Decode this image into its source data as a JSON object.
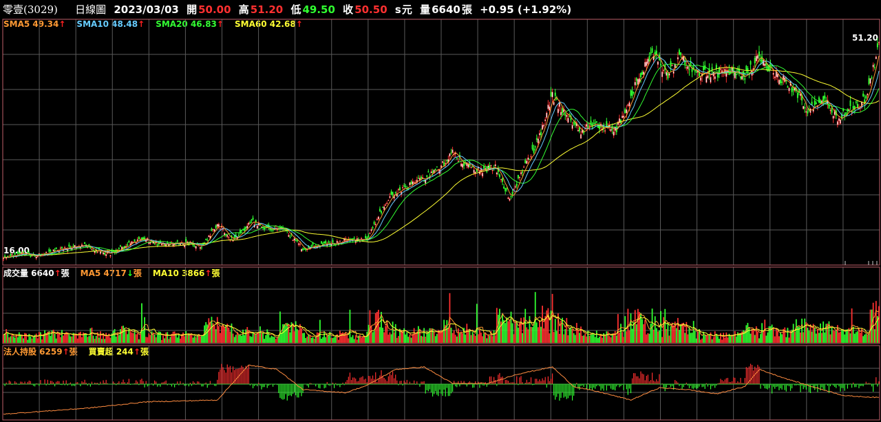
{
  "header": {
    "stock_name": "零壹(3029)",
    "chart_kind": "日線圖",
    "date": "2023/03/03",
    "open_label": "開",
    "open_value": "50.00",
    "high_label": "高",
    "high_value": "51.20",
    "low_label": "低",
    "low_value": "49.50",
    "close_label": "收",
    "close_value": "50.50",
    "currency_s": "s",
    "currency_label": "元",
    "volume_label": "量",
    "volume_value": "6640",
    "volume_unit": "張",
    "change": "+0.95 (+1.92%)"
  },
  "price_legend": [
    {
      "label": "SMA5",
      "value": "49.34",
      "color": "#ff9933",
      "dir": "up"
    },
    {
      "label": "SMA10",
      "value": "48.48",
      "color": "#66ccff",
      "dir": "up"
    },
    {
      "label": "SMA20",
      "value": "46.83",
      "color": "#33ff33",
      "dir": "up"
    },
    {
      "label": "SMA60",
      "value": "42.68",
      "color": "#ffff33",
      "dir": "up"
    }
  ],
  "volume_legend": [
    {
      "label": "成交量",
      "value": "6640",
      "unit": "張",
      "color": "#ffffff",
      "dir": "up"
    },
    {
      "label": "MA5",
      "value": "4717",
      "unit": "張",
      "color": "#ff9933",
      "dir": "down"
    },
    {
      "label": "MA10",
      "value": "3866",
      "unit": "張",
      "color": "#ffff33",
      "dir": "up"
    }
  ],
  "inst_legend": [
    {
      "label": "法人持股",
      "value": "6259",
      "unit": "張",
      "color": "#ff9933",
      "dir": "up"
    },
    {
      "label": "買賣超",
      "value": "244",
      "unit": "張",
      "color": "#ffff33",
      "dir": "up"
    }
  ],
  "chart_data": {
    "type": "line",
    "price_max_label": "51.20",
    "price_min_label": "16.00",
    "ylim": [
      16.0,
      51.2
    ],
    "colors": {
      "up": "#ff3030",
      "down": "#30ff30",
      "sma5": "#ff9933",
      "sma10": "#66ccff",
      "sma20": "#33ff33",
      "sma60": "#ffff33",
      "grid": "#5a5a5a",
      "frame": "#c0606a",
      "inst": "#ff8c40"
    },
    "close_keypoints": [
      [
        0,
        17.0
      ],
      [
        10,
        17.8
      ],
      [
        25,
        17.5
      ],
      [
        40,
        18.5
      ],
      [
        55,
        19.2
      ],
      [
        65,
        18.3
      ],
      [
        75,
        17.8
      ],
      [
        90,
        19.5
      ],
      [
        100,
        20.0
      ],
      [
        110,
        19.3
      ],
      [
        125,
        19.6
      ],
      [
        140,
        19.0
      ],
      [
        150,
        22.5
      ],
      [
        160,
        20.0
      ],
      [
        175,
        22.8
      ],
      [
        185,
        21.5
      ],
      [
        195,
        22.0
      ],
      [
        210,
        18.6
      ],
      [
        225,
        19.2
      ],
      [
        240,
        19.8
      ],
      [
        255,
        20.0
      ],
      [
        265,
        24.5
      ],
      [
        275,
        27.5
      ],
      [
        290,
        29.0
      ],
      [
        305,
        31.0
      ],
      [
        315,
        33.5
      ],
      [
        325,
        31.5
      ],
      [
        335,
        30.8
      ],
      [
        345,
        31.2
      ],
      [
        355,
        26.5
      ],
      [
        365,
        31.0
      ],
      [
        375,
        35.5
      ],
      [
        385,
        42.5
      ],
      [
        395,
        39.0
      ],
      [
        405,
        37.0
      ],
      [
        415,
        38.0
      ],
      [
        430,
        37.3
      ],
      [
        445,
        45.0
      ],
      [
        455,
        49.5
      ],
      [
        465,
        45.5
      ],
      [
        475,
        48.5
      ],
      [
        485,
        46.0
      ],
      [
        495,
        45.8
      ],
      [
        510,
        46.2
      ],
      [
        520,
        45.5
      ],
      [
        530,
        48.8
      ],
      [
        540,
        46.0
      ],
      [
        555,
        43.5
      ],
      [
        565,
        40.0
      ],
      [
        575,
        42.2
      ],
      [
        585,
        39.0
      ],
      [
        595,
        40.5
      ],
      [
        605,
        42.0
      ],
      [
        611,
        47.5
      ],
      [
        614,
        50.5
      ]
    ],
    "inst_keypoints": [
      [
        0,
        0.05
      ],
      [
        60,
        0.15
      ],
      [
        100,
        0.25
      ],
      [
        150,
        0.28
      ],
      [
        172,
        0.85
      ],
      [
        192,
        0.78
      ],
      [
        210,
        0.45
      ],
      [
        240,
        0.4
      ],
      [
        255,
        0.52
      ],
      [
        275,
        0.78
      ],
      [
        295,
        0.82
      ],
      [
        315,
        0.55
      ],
      [
        340,
        0.55
      ],
      [
        360,
        0.7
      ],
      [
        385,
        0.82
      ],
      [
        400,
        0.5
      ],
      [
        420,
        0.4
      ],
      [
        440,
        0.28
      ],
      [
        460,
        0.48
      ],
      [
        480,
        0.45
      ],
      [
        500,
        0.38
      ],
      [
        520,
        0.5
      ],
      [
        530,
        0.78
      ],
      [
        550,
        0.62
      ],
      [
        570,
        0.48
      ],
      [
        590,
        0.35
      ],
      [
        614,
        0.32
      ]
    ]
  }
}
